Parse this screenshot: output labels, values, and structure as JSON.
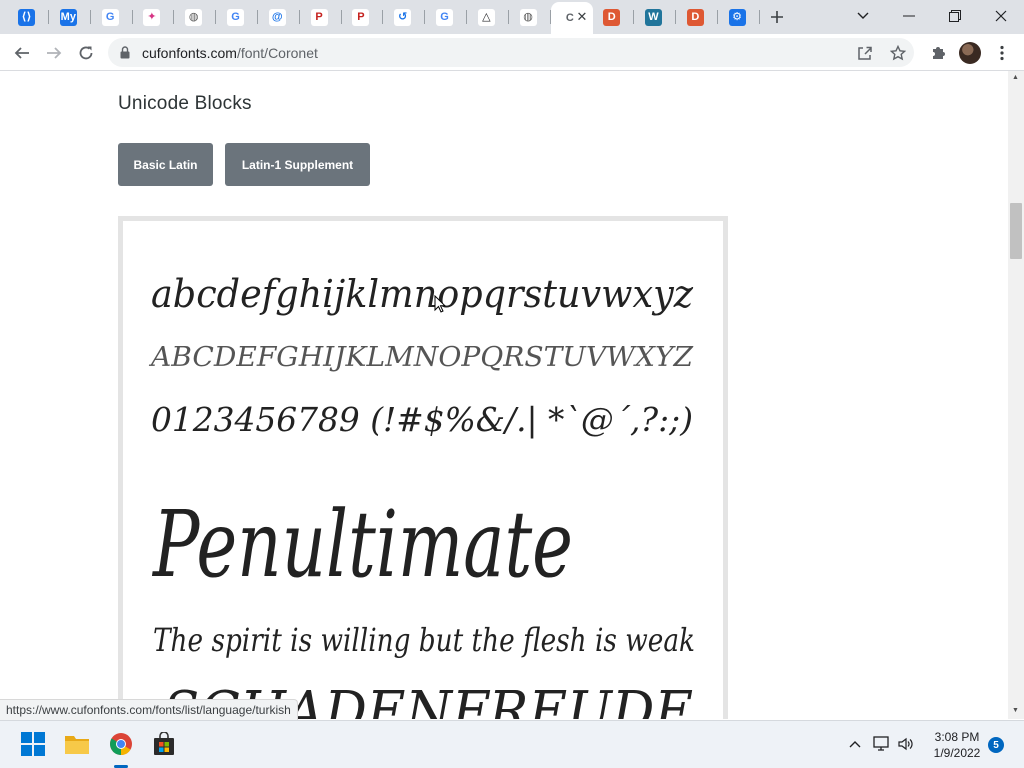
{
  "browser": {
    "tabs": [
      {
        "icon": "code-icon",
        "color": "#1a73e8",
        "glyph": "⟨⟩"
      },
      {
        "icon": "my-icon",
        "color": "#1a73e8",
        "glyph": "My"
      },
      {
        "icon": "google-icon",
        "color": "#ffffff",
        "glyph": "G"
      },
      {
        "icon": "dropbox-icon",
        "color": "#ffffff",
        "glyph": "✦"
      },
      {
        "icon": "globe-icon",
        "color": "#ffffff",
        "glyph": "◍"
      },
      {
        "icon": "google-icon",
        "color": "#ffffff",
        "glyph": "G"
      },
      {
        "icon": "at-sign-icon",
        "color": "#ffffff",
        "glyph": "@"
      },
      {
        "icon": "p-logo-icon",
        "color": "#ffffff",
        "glyph": "P"
      },
      {
        "icon": "p-logo-icon",
        "color": "#ffffff",
        "glyph": "P"
      },
      {
        "icon": "history-icon",
        "color": "#ffffff",
        "glyph": "↺"
      },
      {
        "icon": "google-icon",
        "color": "#ffffff",
        "glyph": "G"
      },
      {
        "icon": "warning-icon",
        "color": "#ffffff",
        "glyph": "△"
      },
      {
        "icon": "globe-icon",
        "color": "#ffffff",
        "glyph": "◍"
      },
      {
        "icon": "cufon-icon",
        "color": "#ffffff",
        "glyph": "C",
        "active": true
      },
      {
        "icon": "duckduckgo-icon",
        "color": "#de5833",
        "glyph": "D"
      },
      {
        "icon": "wordpress-icon",
        "color": "#21759b",
        "glyph": "W"
      },
      {
        "icon": "duckduckgo-icon",
        "color": "#de5833",
        "glyph": "D"
      },
      {
        "icon": "settings-icon",
        "color": "#1a73e8",
        "glyph": "⚙"
      }
    ],
    "url_host": "cufonfonts.com",
    "url_path": "/font/Coronet"
  },
  "page": {
    "section_title": "Unicode Blocks",
    "buttons": [
      "Basic Latin",
      "Latin-1 Supplement"
    ],
    "preview": {
      "lowercase": "abcdefghijklmnopqrstuvwxyz",
      "uppercase": "ABCDEFGHIJKLMNOPQRSTUVWXYZ",
      "numbers": "0123456789 (!#$%&/.|  *`@´,?:;)",
      "word": "Penultimate",
      "sentence": "The spirit is willing but the flesh is weak",
      "cutoff": "SCHADENFREUDE"
    }
  },
  "status_url": "https://www.cufonfonts.com/fonts/list/language/turkish",
  "taskbar": {
    "time": "3:08 PM",
    "date": "1/9/2022",
    "notifications": "5"
  }
}
